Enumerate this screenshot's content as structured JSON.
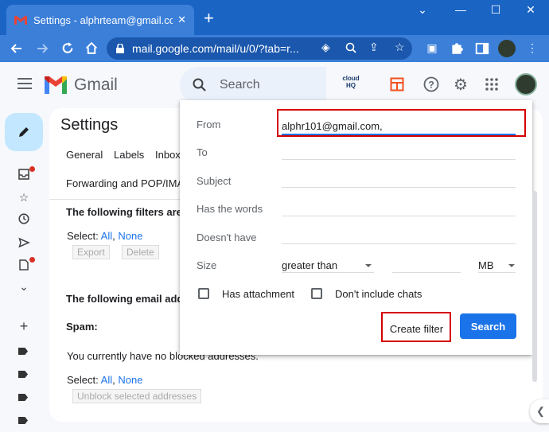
{
  "browser": {
    "tab_title": "Settings - alphrteam@gmail.com",
    "tab_close": "✕",
    "new_tab": "+",
    "url": "mail.google.com/mail/u/0/?tab=r...",
    "controls": {
      "minimize": "⌄",
      "maximize": "☐",
      "close": "✕",
      "restore": "—"
    }
  },
  "gmail": {
    "app_name": "Gmail",
    "search_placeholder": "Search",
    "cloudhq_label": "cloud HQ"
  },
  "settings": {
    "title": "Settings",
    "tabs": [
      "General",
      "Labels",
      "Inbox"
    ],
    "tabs_row2": "Forwarding and POP/IMAP",
    "filters_heading": "The following filters are",
    "select_label": "Select:",
    "select_all": "All",
    "select_none": "None",
    "export_button": "Export",
    "delete_button": "Delete",
    "blocked_heading": "The following email add",
    "spam_label": "Spam:",
    "no_blocked_text": "You currently have no blocked addresses.",
    "select_label2": "Select:",
    "select_all2": "All",
    "select_none2": "None",
    "unblock_button": "Unblock selected addresses"
  },
  "filter_popup": {
    "from_label": "From",
    "from_value": "alphr101@gmail.com,",
    "to_label": "To",
    "subject_label": "Subject",
    "has_words_label": "Has the words",
    "doesnt_have_label": "Doesn't have",
    "size_label": "Size",
    "size_operator": "greater than",
    "size_unit": "MB",
    "has_attachment_label": "Has attachment",
    "dont_include_chats_label": "Don't include chats",
    "create_filter_button": "Create filter",
    "search_button": "Search"
  },
  "colors": {
    "chrome_blue": "#1a64c4",
    "gmail_blue": "#1a73e8",
    "highlight_red": "#d50000"
  }
}
